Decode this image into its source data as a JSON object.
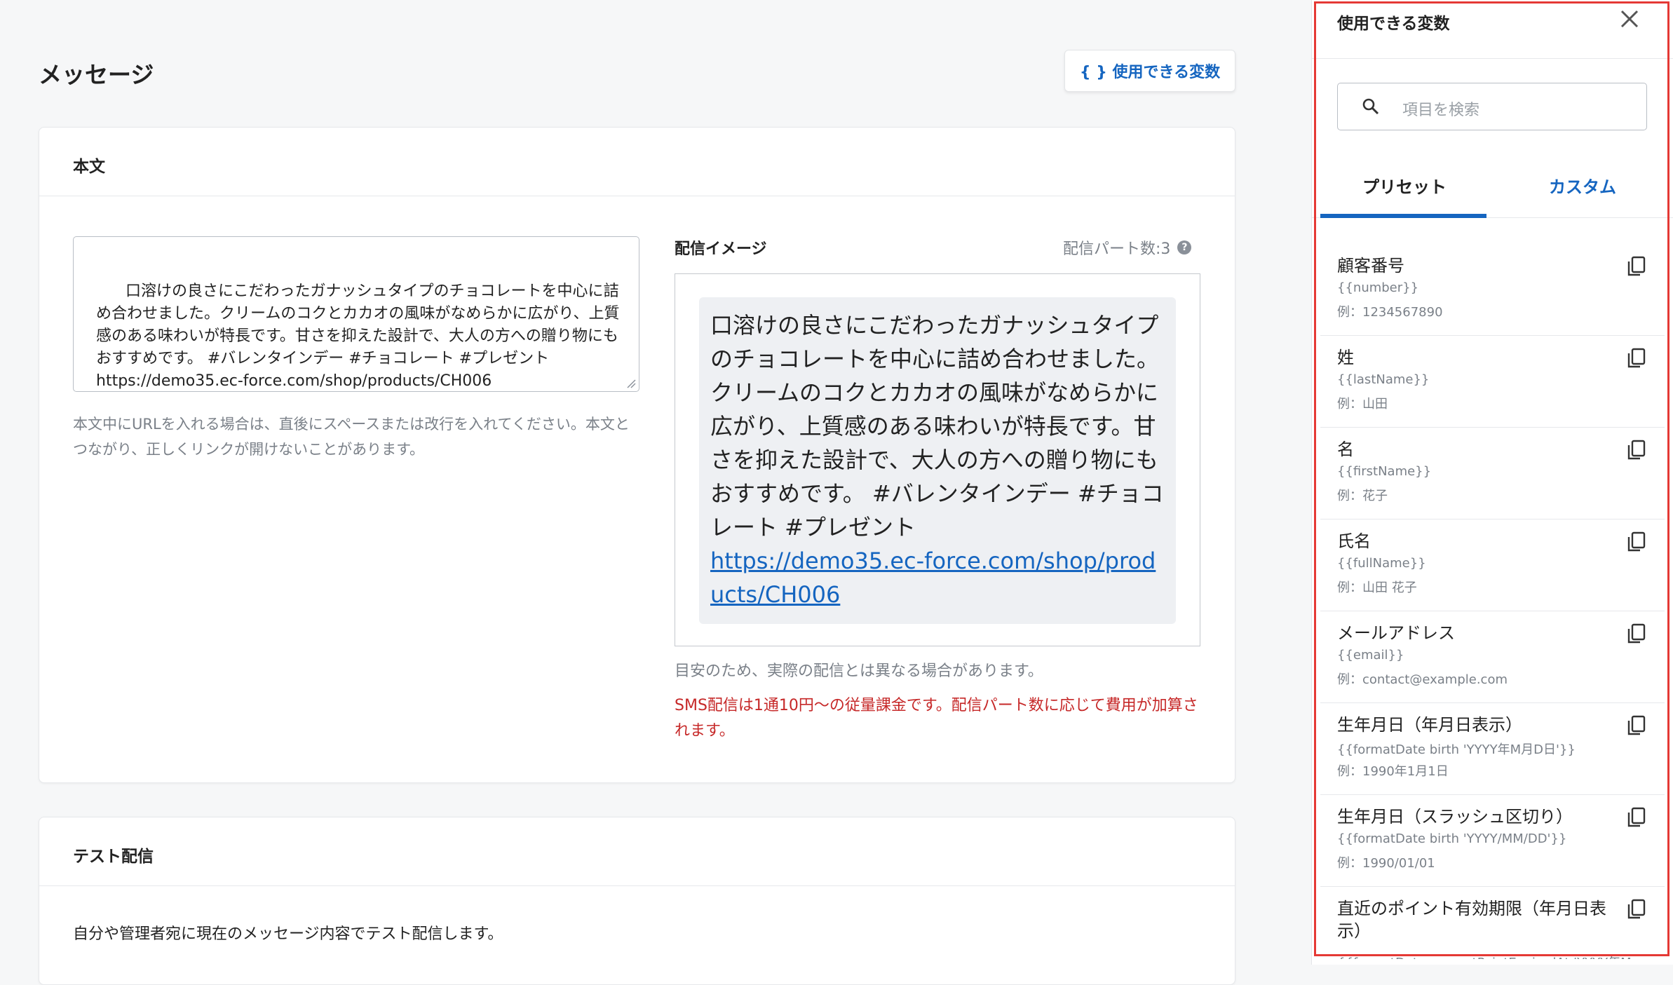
{
  "main": {
    "title": "メッセージ",
    "vars_button": "{ } 使用できる変数"
  },
  "body_card": {
    "title": "本文",
    "textarea_value": "口溶けの良さにこだわったガナッシュタイプのチョコレートを中心に詰め合わせました。クリームのコクとカカオの風味がなめらかに広がり、上質感のある味わいが特長です。甘さを抑えた設計で、大人の方への贈り物にもおすすめです。 #バレンタインデー #チョコレート #プレゼント\nhttps://demo35.ec-force.com/shop/products/CH006",
    "help": "本文中にURLを入れる場合は、直後にスペースまたは改行を入れてください。本文とつながり、正しくリンクが開けないことがあります。",
    "preview_label": "配信イメージ",
    "part_count": "配信パート数:3",
    "help_icon": "question-circle-icon",
    "preview_text": "口溶けの良さにこだわったガナッシュタイプのチョコレートを中心に詰め合わせました。クリームのコクとカカオの風味がなめらかに広がり、上質感のある味わいが特長です。甘さを抑えた設計で、大人の方への贈り物にもおすすめです。 #バレンタインデー #チョコレート #プレゼント",
    "preview_link": "https://demo35.ec-force.com/shop/products/CH006",
    "note": "目安のため、実際の配信とは異なる場合があります。",
    "warning": "SMS配信は1通10円〜の従量課金です。配信パート数に応じて費用が加算されます。"
  },
  "test_card": {
    "title": "テスト配信",
    "description": "自分や管理者宛に現在のメッセージ内容でテスト配信します。"
  },
  "panel": {
    "title": "使用できる変数",
    "search_placeholder": "項目を検索",
    "tabs": [
      "プリセット",
      "カスタム"
    ],
    "active_tab": "プリセット",
    "items": [
      {
        "name": "顧客番号",
        "code": "{{number}}",
        "example": "例：1234567890"
      },
      {
        "name": "姓",
        "code": "{{lastName}}",
        "example": "例：山田"
      },
      {
        "name": "名",
        "code": "{{firstName}}",
        "example": "例：花子"
      },
      {
        "name": "氏名",
        "code": "{{fullName}}",
        "example": "例：山田 花子"
      },
      {
        "name": "メールアドレス",
        "code": "{{email}}",
        "example": "例：contact@example.com"
      },
      {
        "name": "生年月日（年月日表示）",
        "code": "{{formatDate birth 'YYYY年M月D日'}}",
        "example": "例：1990年1月1日"
      },
      {
        "name": "生年月日（スラッシュ区切り）",
        "code": "{{formatDate birth 'YYYY/MM/DD'}}",
        "example": "例：1990/01/01"
      },
      {
        "name": "直近のポイント有効期限（年月日表示）",
        "code": "{{formatDate nearestPointExpiredAt 'YYYY年M",
        "example": ""
      }
    ],
    "highlight_color": "#e53935",
    "accent_color": "#1565c0"
  }
}
